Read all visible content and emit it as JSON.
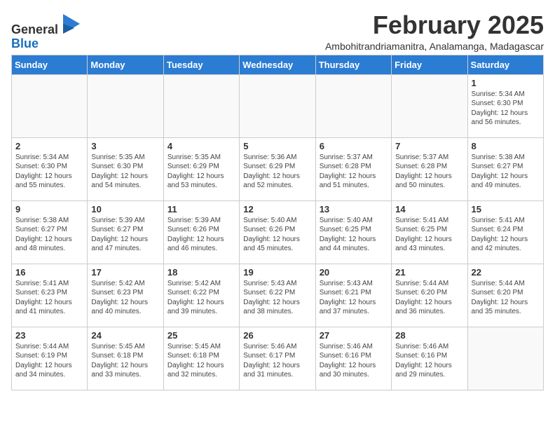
{
  "header": {
    "logo_general": "General",
    "logo_blue": "Blue",
    "title": "February 2025",
    "subtitle": "Ambohitrandriamanitra, Analamanga, Madagascar"
  },
  "days_of_week": [
    "Sunday",
    "Monday",
    "Tuesday",
    "Wednesday",
    "Thursday",
    "Friday",
    "Saturday"
  ],
  "weeks": [
    [
      {
        "day": "",
        "info": ""
      },
      {
        "day": "",
        "info": ""
      },
      {
        "day": "",
        "info": ""
      },
      {
        "day": "",
        "info": ""
      },
      {
        "day": "",
        "info": ""
      },
      {
        "day": "",
        "info": ""
      },
      {
        "day": "1",
        "info": "Sunrise: 5:34 AM\nSunset: 6:30 PM\nDaylight: 12 hours\nand 56 minutes."
      }
    ],
    [
      {
        "day": "2",
        "info": "Sunrise: 5:34 AM\nSunset: 6:30 PM\nDaylight: 12 hours\nand 55 minutes."
      },
      {
        "day": "3",
        "info": "Sunrise: 5:35 AM\nSunset: 6:30 PM\nDaylight: 12 hours\nand 54 minutes."
      },
      {
        "day": "4",
        "info": "Sunrise: 5:35 AM\nSunset: 6:29 PM\nDaylight: 12 hours\nand 53 minutes."
      },
      {
        "day": "5",
        "info": "Sunrise: 5:36 AM\nSunset: 6:29 PM\nDaylight: 12 hours\nand 52 minutes."
      },
      {
        "day": "6",
        "info": "Sunrise: 5:37 AM\nSunset: 6:28 PM\nDaylight: 12 hours\nand 51 minutes."
      },
      {
        "day": "7",
        "info": "Sunrise: 5:37 AM\nSunset: 6:28 PM\nDaylight: 12 hours\nand 50 minutes."
      },
      {
        "day": "8",
        "info": "Sunrise: 5:38 AM\nSunset: 6:27 PM\nDaylight: 12 hours\nand 49 minutes."
      }
    ],
    [
      {
        "day": "9",
        "info": "Sunrise: 5:38 AM\nSunset: 6:27 PM\nDaylight: 12 hours\nand 48 minutes."
      },
      {
        "day": "10",
        "info": "Sunrise: 5:39 AM\nSunset: 6:27 PM\nDaylight: 12 hours\nand 47 minutes."
      },
      {
        "day": "11",
        "info": "Sunrise: 5:39 AM\nSunset: 6:26 PM\nDaylight: 12 hours\nand 46 minutes."
      },
      {
        "day": "12",
        "info": "Sunrise: 5:40 AM\nSunset: 6:26 PM\nDaylight: 12 hours\nand 45 minutes."
      },
      {
        "day": "13",
        "info": "Sunrise: 5:40 AM\nSunset: 6:25 PM\nDaylight: 12 hours\nand 44 minutes."
      },
      {
        "day": "14",
        "info": "Sunrise: 5:41 AM\nSunset: 6:25 PM\nDaylight: 12 hours\nand 43 minutes."
      },
      {
        "day": "15",
        "info": "Sunrise: 5:41 AM\nSunset: 6:24 PM\nDaylight: 12 hours\nand 42 minutes."
      }
    ],
    [
      {
        "day": "16",
        "info": "Sunrise: 5:41 AM\nSunset: 6:23 PM\nDaylight: 12 hours\nand 41 minutes."
      },
      {
        "day": "17",
        "info": "Sunrise: 5:42 AM\nSunset: 6:23 PM\nDaylight: 12 hours\nand 40 minutes."
      },
      {
        "day": "18",
        "info": "Sunrise: 5:42 AM\nSunset: 6:22 PM\nDaylight: 12 hours\nand 39 minutes."
      },
      {
        "day": "19",
        "info": "Sunrise: 5:43 AM\nSunset: 6:22 PM\nDaylight: 12 hours\nand 38 minutes."
      },
      {
        "day": "20",
        "info": "Sunrise: 5:43 AM\nSunset: 6:21 PM\nDaylight: 12 hours\nand 37 minutes."
      },
      {
        "day": "21",
        "info": "Sunrise: 5:44 AM\nSunset: 6:20 PM\nDaylight: 12 hours\nand 36 minutes."
      },
      {
        "day": "22",
        "info": "Sunrise: 5:44 AM\nSunset: 6:20 PM\nDaylight: 12 hours\nand 35 minutes."
      }
    ],
    [
      {
        "day": "23",
        "info": "Sunrise: 5:44 AM\nSunset: 6:19 PM\nDaylight: 12 hours\nand 34 minutes."
      },
      {
        "day": "24",
        "info": "Sunrise: 5:45 AM\nSunset: 6:18 PM\nDaylight: 12 hours\nand 33 minutes."
      },
      {
        "day": "25",
        "info": "Sunrise: 5:45 AM\nSunset: 6:18 PM\nDaylight: 12 hours\nand 32 minutes."
      },
      {
        "day": "26",
        "info": "Sunrise: 5:46 AM\nSunset: 6:17 PM\nDaylight: 12 hours\nand 31 minutes."
      },
      {
        "day": "27",
        "info": "Sunrise: 5:46 AM\nSunset: 6:16 PM\nDaylight: 12 hours\nand 30 minutes."
      },
      {
        "day": "28",
        "info": "Sunrise: 5:46 AM\nSunset: 6:16 PM\nDaylight: 12 hours\nand 29 minutes."
      },
      {
        "day": "",
        "info": ""
      }
    ]
  ]
}
